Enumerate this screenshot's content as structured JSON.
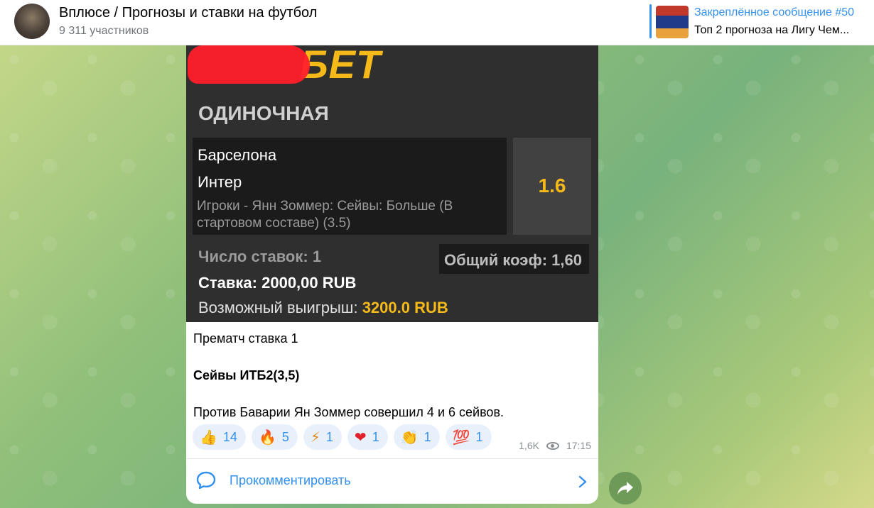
{
  "header": {
    "title": "Вплюсе / Прогнозы и ставки на футбол",
    "subscribers": "9 311 участников",
    "pinned": {
      "title": "Закреплённое сообщение #50",
      "text": "Топ 2 прогноза на Лигу Чем..."
    }
  },
  "bet_slip": {
    "logo_text": "БЕТ",
    "type_label": "ОДИНОЧНАЯ",
    "team1": "Барселона",
    "team2": "Интер",
    "market": "Игроки - Янн Зоммер: Сейвы: Больше (В стартовом составе) (3.5)",
    "odd": "1.6",
    "bet_count": "Число ставок: 1",
    "total_coef": "Общий коэф: 1,60",
    "stake": "Ставка: 2000,00 RUB",
    "win_label": "Возможный выигрыш: ",
    "win_value": "3200.0 RUB"
  },
  "message": {
    "line1": "Прематч ставка 1",
    "line2": "Сейвы ИТБ2(3,5)",
    "line3": "Против Баварии Ян Зоммер совершил 4 и 6 сейвов.",
    "views": "1,6K",
    "time": "17:15"
  },
  "reactions": [
    {
      "emoji": "👍",
      "icon": "thumbs-up-icon",
      "count": "14"
    },
    {
      "emoji": "🔥",
      "icon": "fire-icon",
      "count": "5"
    },
    {
      "emoji": "⚡",
      "icon": "lightning-icon",
      "count": "1"
    },
    {
      "emoji": "❤",
      "icon": "heart-icon",
      "count": "1"
    },
    {
      "emoji": "👏",
      "icon": "clap-icon",
      "count": "1"
    },
    {
      "emoji": "💯",
      "icon": "hundred-icon",
      "count": "1"
    }
  ],
  "comment": {
    "label": "Прокомментировать"
  },
  "colors": {
    "accent": "#3390ec",
    "bet_yellow": "#f6b91a",
    "slip_bg": "#2f2f2f"
  }
}
